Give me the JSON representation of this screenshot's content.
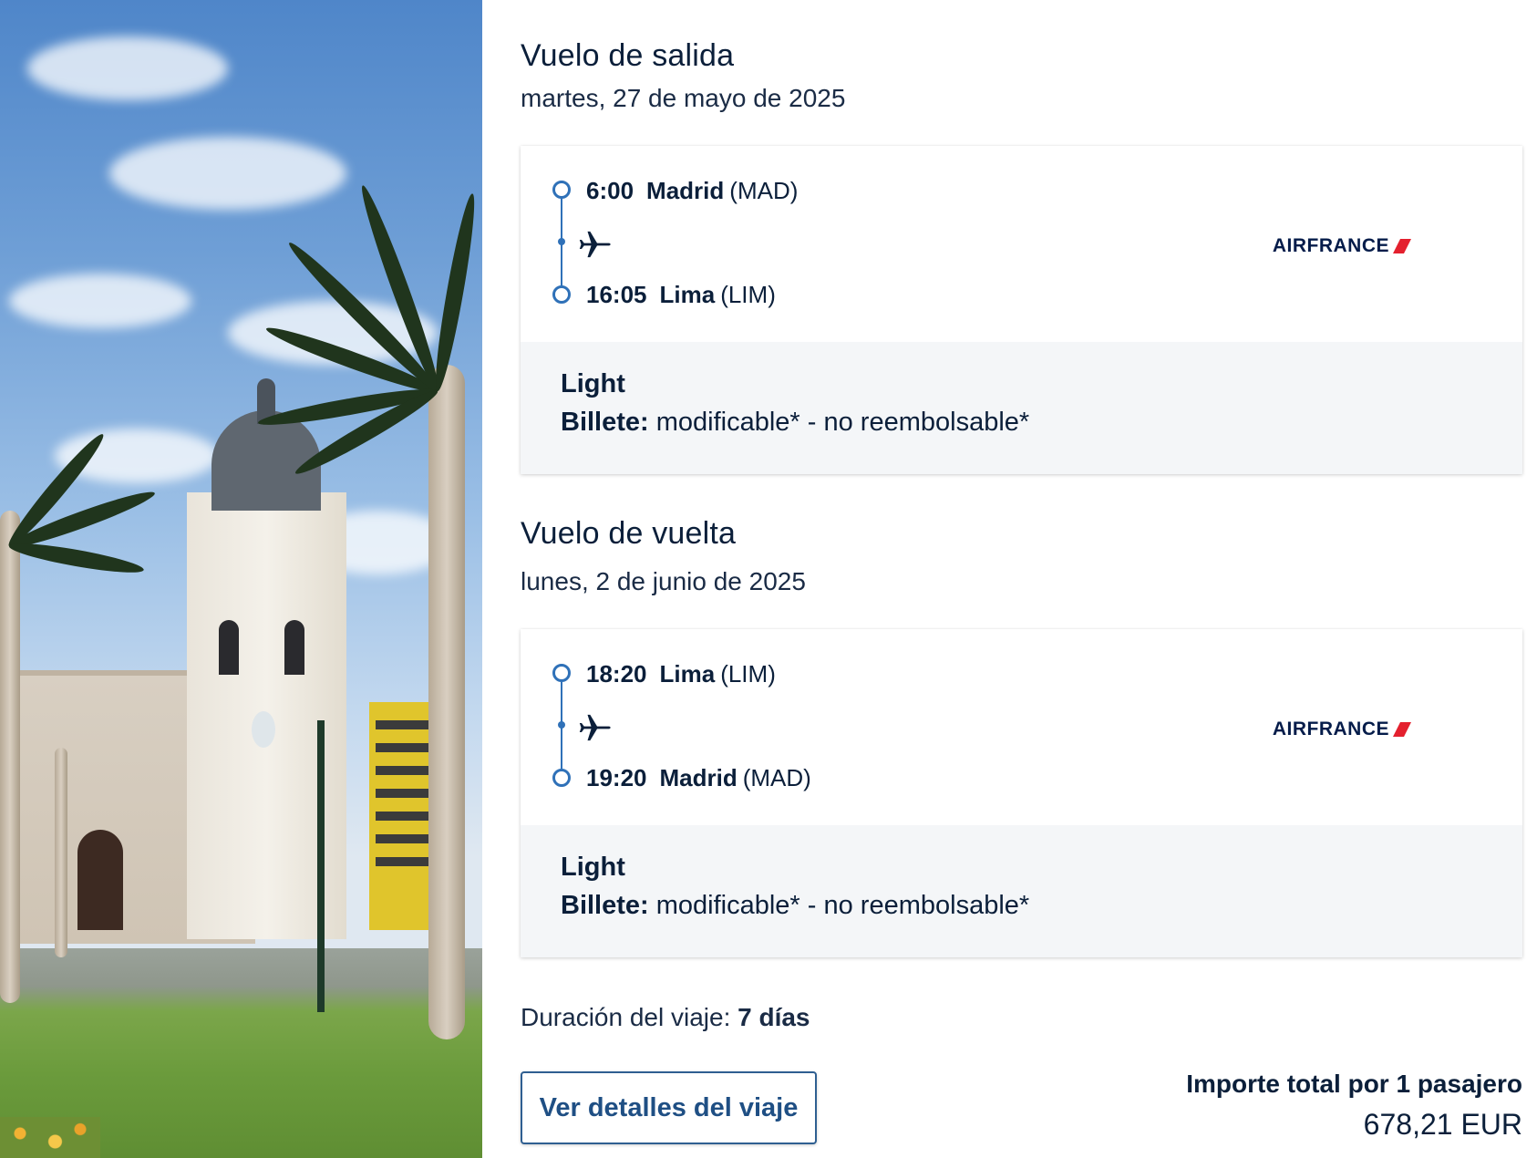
{
  "outbound": {
    "title": "Vuelo de salida",
    "date": "martes, 27 de mayo de 2025",
    "departure": {
      "time": "6:00",
      "city": "Madrid",
      "code": "(MAD)"
    },
    "arrival": {
      "time": "16:05",
      "city": "Lima",
      "code": "(LIM)"
    },
    "airline": "AIRFRANCE",
    "fare": {
      "name": "Light",
      "ticket_label": "Billete:",
      "ticket_value": "modificable* - no reembolsable*"
    }
  },
  "return": {
    "title": "Vuelo de vuelta",
    "date": "lunes, 2 de junio de 2025",
    "departure": {
      "time": "18:20",
      "city": "Lima",
      "code": "(LIM)"
    },
    "arrival": {
      "time": "19:20",
      "city": "Madrid",
      "code": "(MAD)"
    },
    "airline": "AIRFRANCE",
    "fare": {
      "name": "Light",
      "ticket_label": "Billete:",
      "ticket_value": "modificable* - no reembolsable*"
    }
  },
  "trip": {
    "duration_label": "Duración del viaje:",
    "duration_value": "7 días"
  },
  "actions": {
    "details_button": "Ver detalles del viaje"
  },
  "total": {
    "label": "Importe total por 1 pasajero",
    "value": "678,21 EUR"
  },
  "colors": {
    "text": "#0b1f3a",
    "timeline": "#2f71b8",
    "button_border": "#2f5f91",
    "fare_bg": "#f4f6f8",
    "airline_red": "#e4202e"
  },
  "icons": [
    "plane-icon",
    "airfrance-logo"
  ],
  "photo": {
    "subject": "cathedral-lima-plaza"
  }
}
